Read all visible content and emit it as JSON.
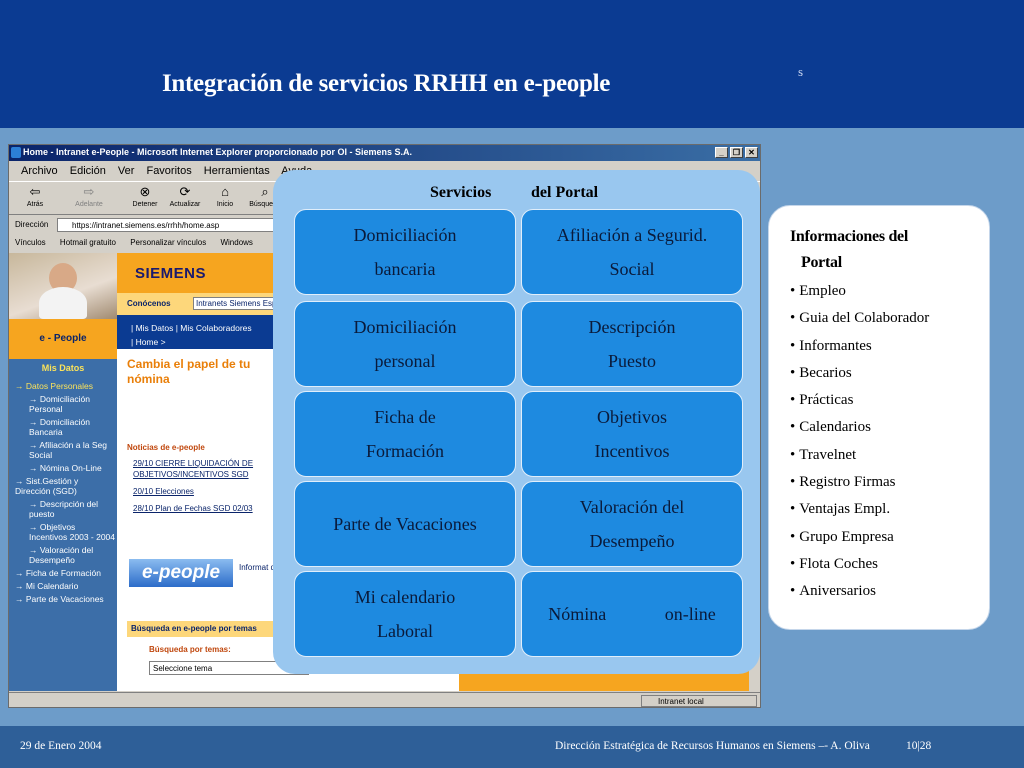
{
  "slide": {
    "title": "Integración de servicios RRHH en e-people",
    "corner_mark": "s",
    "footer_date": "29 de Enero 2004",
    "footer_credit": "Dirección Estratégica de Recursos Humanos en Siemens –- A. Oliva",
    "footer_page": "10|28"
  },
  "browser": {
    "title": "Home - Intranet e-People - Microsoft Internet Explorer proporcionado por OI - Siemens S.A.",
    "menu": [
      "Archivo",
      "Edición",
      "Ver",
      "Favoritos",
      "Herramientas",
      "Ayuda"
    ],
    "toolbar": [
      "Atrás",
      "Adelante",
      "Detener",
      "Actualizar",
      "Inicio",
      "Búsqueda"
    ],
    "address_label": "Dirección",
    "address_value": "https://intranet.siemens.es/rrhh/home.asp",
    "links_label": "Vínculos",
    "links": [
      "Hotmail gratuito",
      "Personalizar vínculos",
      "Windows"
    ],
    "status_zone": "Intranet local"
  },
  "webpage": {
    "brand_logo": "SIEMENS",
    "conocenos_label": "Conócenos",
    "conocenos_select": "Intranets Siemens Esp",
    "crumb_1": "| Mis Datos  |  Mis Colaboradores",
    "crumb_2": "| Home >",
    "nav_brand": "e - People",
    "nav_section": "Mis Datos",
    "nav_items": [
      {
        "label": "Datos Personales",
        "level": 0
      },
      {
        "label": "Domiciliación Personal",
        "level": 1
      },
      {
        "label": "Domiciliación Bancaria",
        "level": 1
      },
      {
        "label": "Afiliación a la Seg Social",
        "level": 1
      },
      {
        "label": "Nómina On-Line",
        "level": 1
      },
      {
        "label": "Sist.Gestión y Dirección (SGD)",
        "level": 0
      },
      {
        "label": "Descripción del puesto",
        "level": 1
      },
      {
        "label": "Objetivos Incentivos 2003 - 2004",
        "level": 1
      },
      {
        "label": "Valoración del Desempeño",
        "level": 1
      },
      {
        "label": "Ficha de Formación",
        "level": 0
      },
      {
        "label": "Mi Calendario",
        "level": 0
      },
      {
        "label": "Parte de Vacaciones",
        "level": 0
      }
    ],
    "promo_text": "Cambia el papel de tu nómina",
    "news_title": "Noticias de e-people",
    "news_items": [
      "29/10 CIERRE LIQUIDACIÓN DE OBJETIVOS/INCENTIVOS SGD",
      "20/10 Elecciones",
      "28/10 Plan de Fechas SGD 02/03"
    ],
    "eppl_logo": "e-people",
    "info_text": "Informat que lo ha",
    "search_title": "Búsqueda en e-people por temas",
    "search_sub": "Búsqueda por temas:",
    "search_select": "Seleccione tema"
  },
  "services": {
    "heading_1": "Servicios",
    "heading_2": "del Portal",
    "items": [
      {
        "line1": "Domiciliación",
        "line2": "bancaria"
      },
      {
        "line1": "Afiliación a Segurid.",
        "line2": "Social"
      },
      {
        "line1": "Domiciliación",
        "line2": "personal"
      },
      {
        "line1": "Descripción",
        "line2": "Puesto"
      },
      {
        "line1": "Ficha de",
        "line2": "Formación"
      },
      {
        "line1": "Objetivos",
        "line2": "Incentivos"
      },
      {
        "line1": "Parte de Vacaciones",
        "line2": ""
      },
      {
        "line1": "Valoración del",
        "line2": "Desempeño"
      },
      {
        "line1": "Mi calendario",
        "line2": "Laboral"
      },
      {
        "line1": "Nómina             on-line",
        "line2": ""
      }
    ]
  },
  "info": {
    "heading_line1": "Informaciones del",
    "heading_line2": "Portal",
    "items": [
      "Empleo",
      "Guia del Colaborador",
      "Informantes",
      "Becarios",
      "Prácticas",
      "Calendarios",
      "Travelnet",
      "Registro Firmas",
      "Ventajas Empl.",
      "Grupo Empresa",
      "Flota Coches",
      "Aniversarios"
    ]
  },
  "colors": {
    "header_blue": "#0b3b92",
    "slide_background": "#6d9cc9",
    "service_button": "#1e8ae0",
    "services_panel": "#99c7ef",
    "siemens_orange": "#f6a51f"
  }
}
